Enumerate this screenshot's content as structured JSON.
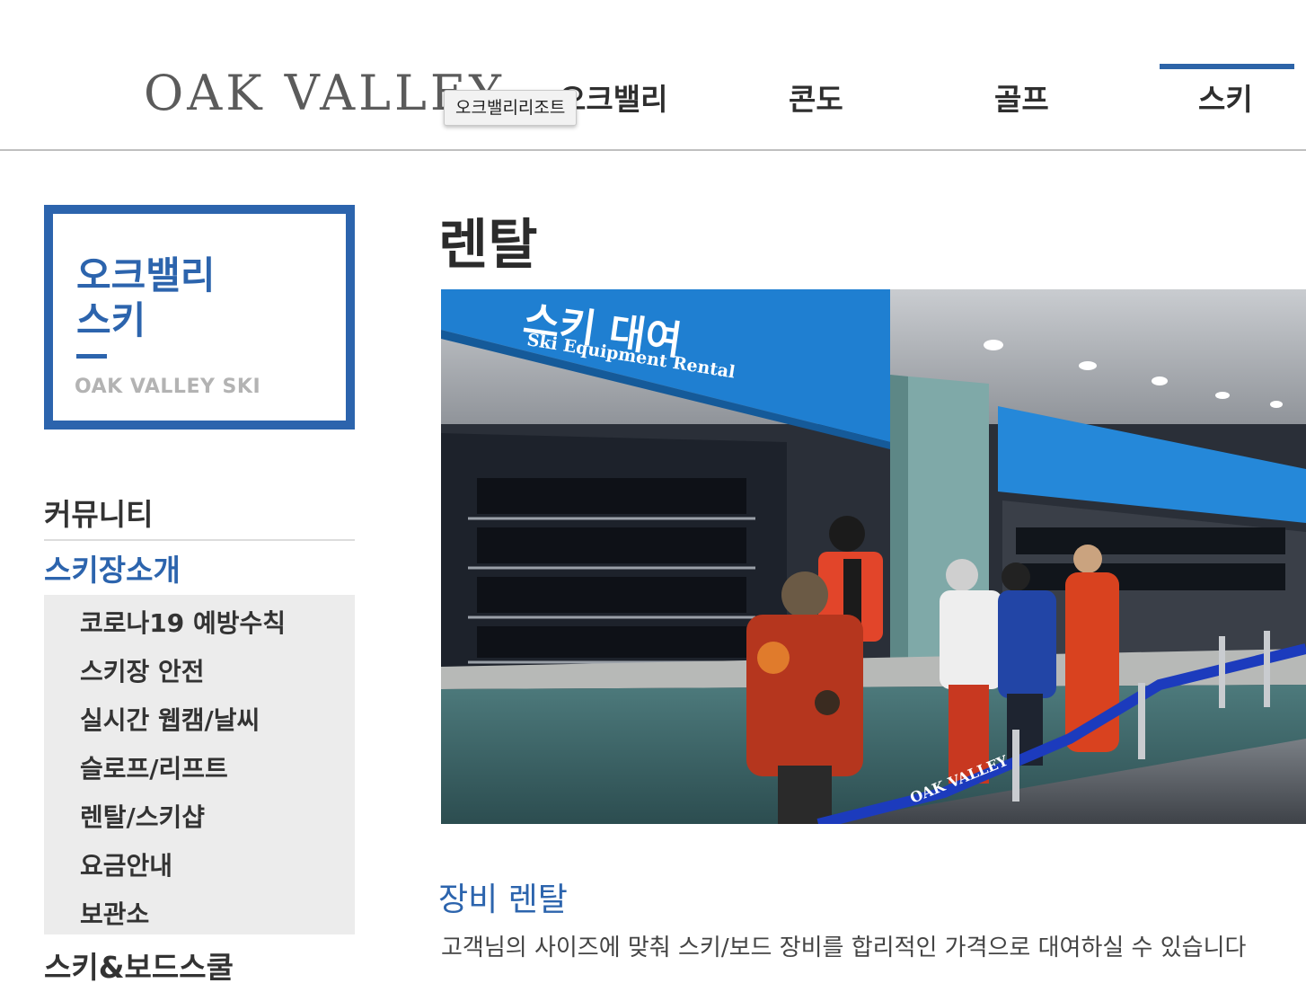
{
  "header": {
    "logo_text": "OAK VALLEY",
    "tooltip": "오크밸리리조트",
    "nav": [
      {
        "label": "오크밸리"
      },
      {
        "label": "콘도"
      },
      {
        "label": "골프"
      },
      {
        "label": "스키",
        "active": true
      }
    ]
  },
  "sidebar": {
    "brand_title_line1": "오크밸리",
    "brand_title_line2": "스키",
    "brand_subtitle": "OAK VALLEY SKI",
    "sections": [
      {
        "label": "커뮤니티"
      },
      {
        "label": "스키장소개",
        "active": true
      },
      {
        "label": "스키&보드스쿨"
      }
    ],
    "submenu": [
      {
        "label": "코로나19 예방수칙"
      },
      {
        "label": "스키장 안전"
      },
      {
        "label": "실시간 웹캠/날씨"
      },
      {
        "label": "슬로프/리프트"
      },
      {
        "label": "렌탈/스키샵"
      },
      {
        "label": "요금안내"
      },
      {
        "label": "보관소"
      }
    ]
  },
  "main": {
    "page_title": "렌탈",
    "photo": {
      "sign_korean": "스키 대여",
      "sign_english": "Ski Equipment Rental",
      "rope_text": "OAK VALLEY"
    },
    "section_title": "장비 렌탈",
    "section_desc": "고객님의 사이즈에 맞춰 스키/보드 장비를 합리적인 가격으로 대여하실 수 있습니다"
  },
  "colors": {
    "brand_blue": "#2c64ad",
    "nav_active_bar": "#2d64a8",
    "submenu_bg": "#ececec"
  }
}
